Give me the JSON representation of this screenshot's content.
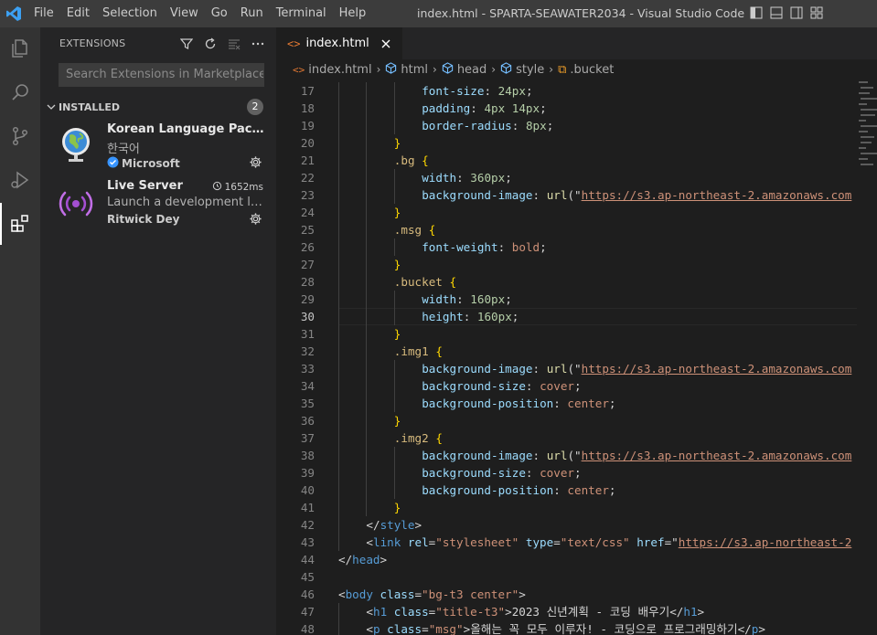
{
  "titlebar": {
    "menu": [
      "File",
      "Edit",
      "Selection",
      "View",
      "Go",
      "Run",
      "Terminal",
      "Help"
    ],
    "window_title": "index.html - SPARTA-SEAWATER2034 - Visual Studio Code"
  },
  "activity_bar": {
    "items": [
      "explorer-icon",
      "search-icon",
      "source-control-icon",
      "run-debug-icon",
      "extensions-icon"
    ],
    "active": "extensions-icon"
  },
  "sidebar": {
    "title": "EXTENSIONS",
    "search_placeholder": "Search Extensions in Marketplace",
    "section": {
      "label": "INSTALLED",
      "count": "2"
    },
    "extensions": [
      {
        "name": "Korean Language Pack for...",
        "description": "한국어",
        "publisher": "Microsoft",
        "verified": true,
        "timing": ""
      },
      {
        "name": "Live Server",
        "description": "Launch a development local...",
        "publisher": "Ritwick Dey",
        "verified": false,
        "timing": "1652ms"
      }
    ]
  },
  "editor": {
    "tab": {
      "label": "index.html",
      "active": true
    },
    "breadcrumb": [
      "index.html",
      "html",
      "head",
      "style",
      ".bucket"
    ],
    "current_line": 30,
    "lines": [
      {
        "n": "17",
        "tokens": [
          [
            "t-prop",
            "font-size"
          ],
          [
            "t-punc",
            ": "
          ],
          [
            "t-num",
            "24px"
          ],
          [
            "t-punc",
            ";"
          ]
        ],
        "indent": 3
      },
      {
        "n": "18",
        "tokens": [
          [
            "t-prop",
            "padding"
          ],
          [
            "t-punc",
            ": "
          ],
          [
            "t-num",
            "4px 14px"
          ],
          [
            "t-punc",
            ";"
          ]
        ],
        "indent": 3
      },
      {
        "n": "19",
        "tokens": [
          [
            "t-prop",
            "border-radius"
          ],
          [
            "t-punc",
            ": "
          ],
          [
            "t-num",
            "8px"
          ],
          [
            "t-punc",
            ";"
          ]
        ],
        "indent": 3
      },
      {
        "n": "20",
        "tokens": [
          [
            "t-brace",
            "}"
          ]
        ],
        "indent": 2
      },
      {
        "n": "21",
        "tokens": [
          [
            "t-sel",
            ".bg"
          ],
          [
            "t-punc",
            " "
          ],
          [
            "t-brace",
            "{"
          ]
        ],
        "indent": 2
      },
      {
        "n": "22",
        "tokens": [
          [
            "t-prop",
            "width"
          ],
          [
            "t-punc",
            ": "
          ],
          [
            "t-num",
            "360px"
          ],
          [
            "t-punc",
            ";"
          ]
        ],
        "indent": 3
      },
      {
        "n": "23",
        "tokens": [
          [
            "t-prop",
            "background-image"
          ],
          [
            "t-punc",
            ": "
          ],
          [
            "t-fn",
            "url"
          ],
          [
            "t-punc",
            "(\""
          ],
          [
            "t-url",
            "https://s3.ap-northeast-2.amazonaws.com"
          ]
        ],
        "indent": 3
      },
      {
        "n": "24",
        "tokens": [
          [
            "t-brace",
            "}"
          ]
        ],
        "indent": 2
      },
      {
        "n": "25",
        "tokens": [
          [
            "t-sel",
            ".msg"
          ],
          [
            "t-punc",
            " "
          ],
          [
            "t-brace",
            "{"
          ]
        ],
        "indent": 2
      },
      {
        "n": "26",
        "tokens": [
          [
            "t-prop",
            "font-weight"
          ],
          [
            "t-punc",
            ": "
          ],
          [
            "t-val",
            "bold"
          ],
          [
            "t-punc",
            ";"
          ]
        ],
        "indent": 3
      },
      {
        "n": "27",
        "tokens": [
          [
            "t-brace",
            "}"
          ]
        ],
        "indent": 2
      },
      {
        "n": "28",
        "tokens": [
          [
            "t-sel",
            ".bucket"
          ],
          [
            "t-punc",
            " "
          ],
          [
            "t-brace",
            "{"
          ]
        ],
        "indent": 2
      },
      {
        "n": "29",
        "tokens": [
          [
            "t-prop",
            "width"
          ],
          [
            "t-punc",
            ": "
          ],
          [
            "t-num",
            "160px"
          ],
          [
            "t-punc",
            ";"
          ]
        ],
        "indent": 3
      },
      {
        "n": "30",
        "tokens": [
          [
            "t-prop",
            "height"
          ],
          [
            "t-punc",
            ": "
          ],
          [
            "t-num",
            "160px"
          ],
          [
            "t-punc",
            ";"
          ]
        ],
        "indent": 3
      },
      {
        "n": "31",
        "tokens": [
          [
            "t-brace",
            "}"
          ]
        ],
        "indent": 2
      },
      {
        "n": "32",
        "tokens": [
          [
            "t-sel",
            ".img1"
          ],
          [
            "t-punc",
            " "
          ],
          [
            "t-brace",
            "{"
          ]
        ],
        "indent": 2
      },
      {
        "n": "33",
        "tokens": [
          [
            "t-prop",
            "background-image"
          ],
          [
            "t-punc",
            ": "
          ],
          [
            "t-fn",
            "url"
          ],
          [
            "t-punc",
            "(\""
          ],
          [
            "t-url",
            "https://s3.ap-northeast-2.amazonaws.com"
          ]
        ],
        "indent": 3
      },
      {
        "n": "34",
        "tokens": [
          [
            "t-prop",
            "background-size"
          ],
          [
            "t-punc",
            ": "
          ],
          [
            "t-val",
            "cover"
          ],
          [
            "t-punc",
            ";"
          ]
        ],
        "indent": 3
      },
      {
        "n": "35",
        "tokens": [
          [
            "t-prop",
            "background-position"
          ],
          [
            "t-punc",
            ": "
          ],
          [
            "t-val",
            "center"
          ],
          [
            "t-punc",
            ";"
          ]
        ],
        "indent": 3
      },
      {
        "n": "36",
        "tokens": [
          [
            "t-brace",
            "}"
          ]
        ],
        "indent": 2
      },
      {
        "n": "37",
        "tokens": [
          [
            "t-sel",
            ".img2"
          ],
          [
            "t-punc",
            " "
          ],
          [
            "t-brace",
            "{"
          ]
        ],
        "indent": 2
      },
      {
        "n": "38",
        "tokens": [
          [
            "t-prop",
            "background-image"
          ],
          [
            "t-punc",
            ": "
          ],
          [
            "t-fn",
            "url"
          ],
          [
            "t-punc",
            "(\""
          ],
          [
            "t-url",
            "https://s3.ap-northeast-2.amazonaws.com"
          ]
        ],
        "indent": 3
      },
      {
        "n": "39",
        "tokens": [
          [
            "t-prop",
            "background-size"
          ],
          [
            "t-punc",
            ": "
          ],
          [
            "t-val",
            "cover"
          ],
          [
            "t-punc",
            ";"
          ]
        ],
        "indent": 3
      },
      {
        "n": "40",
        "tokens": [
          [
            "t-prop",
            "background-position"
          ],
          [
            "t-punc",
            ": "
          ],
          [
            "t-val",
            "center"
          ],
          [
            "t-punc",
            ";"
          ]
        ],
        "indent": 3
      },
      {
        "n": "41",
        "tokens": [
          [
            "t-brace",
            "}"
          ]
        ],
        "indent": 2
      },
      {
        "n": "42",
        "tokens": [
          [
            "t-punc",
            "</"
          ],
          [
            "t-tag",
            "style"
          ],
          [
            "t-punc",
            ">"
          ]
        ],
        "indent": 1
      },
      {
        "n": "43",
        "tokens": [
          [
            "t-punc",
            "<"
          ],
          [
            "t-tag",
            "link"
          ],
          [
            "t-punc",
            " "
          ],
          [
            "t-attr",
            "rel"
          ],
          [
            "t-punc",
            "="
          ],
          [
            "t-str",
            "\"stylesheet\""
          ],
          [
            "t-punc",
            " "
          ],
          [
            "t-attr",
            "type"
          ],
          [
            "t-punc",
            "="
          ],
          [
            "t-str",
            "\"text/css\""
          ],
          [
            "t-punc",
            " "
          ],
          [
            "t-attr",
            "href"
          ],
          [
            "t-punc",
            "=\""
          ],
          [
            "t-url",
            "https://s3.ap-northeast-2"
          ]
        ],
        "indent": 1
      },
      {
        "n": "44",
        "tokens": [
          [
            "t-punc",
            "</"
          ],
          [
            "t-tag",
            "head"
          ],
          [
            "t-punc",
            ">"
          ]
        ],
        "indent": 0
      },
      {
        "n": "45",
        "tokens": [],
        "indent": 0
      },
      {
        "n": "46",
        "tokens": [
          [
            "t-punc",
            "<"
          ],
          [
            "t-tag",
            "body"
          ],
          [
            "t-punc",
            " "
          ],
          [
            "t-attr",
            "class"
          ],
          [
            "t-punc",
            "="
          ],
          [
            "t-str",
            "\"bg-t3 center\""
          ],
          [
            "t-punc",
            ">"
          ]
        ],
        "indent": 0
      },
      {
        "n": "47",
        "tokens": [
          [
            "t-punc",
            "<"
          ],
          [
            "t-tag",
            "h1"
          ],
          [
            "t-punc",
            " "
          ],
          [
            "t-attr",
            "class"
          ],
          [
            "t-punc",
            "="
          ],
          [
            "t-str",
            "\"title-t3\""
          ],
          [
            "t-punc",
            ">"
          ],
          [
            "t-text",
            "2023 신년계획 - 코딩 배우기"
          ],
          [
            "t-punc",
            "</"
          ],
          [
            "t-tag",
            "h1"
          ],
          [
            "t-punc",
            ">"
          ]
        ],
        "indent": 1
      },
      {
        "n": "48",
        "tokens": [
          [
            "t-punc",
            "<"
          ],
          [
            "t-tag",
            "p"
          ],
          [
            "t-punc",
            " "
          ],
          [
            "t-attr",
            "class"
          ],
          [
            "t-punc",
            "="
          ],
          [
            "t-str",
            "\"msg\""
          ],
          [
            "t-punc",
            ">"
          ],
          [
            "t-text",
            "올해는 꼭 모두 이루자! - 코딩으로 프로그래밍하기"
          ],
          [
            "t-punc",
            "</"
          ],
          [
            "t-tag",
            "p"
          ],
          [
            "t-punc",
            ">"
          ]
        ],
        "indent": 1
      }
    ]
  },
  "colors": {
    "accent": "#007acc",
    "live_server_icon": "#a34fd1",
    "verified_badge": "#3794ff"
  }
}
